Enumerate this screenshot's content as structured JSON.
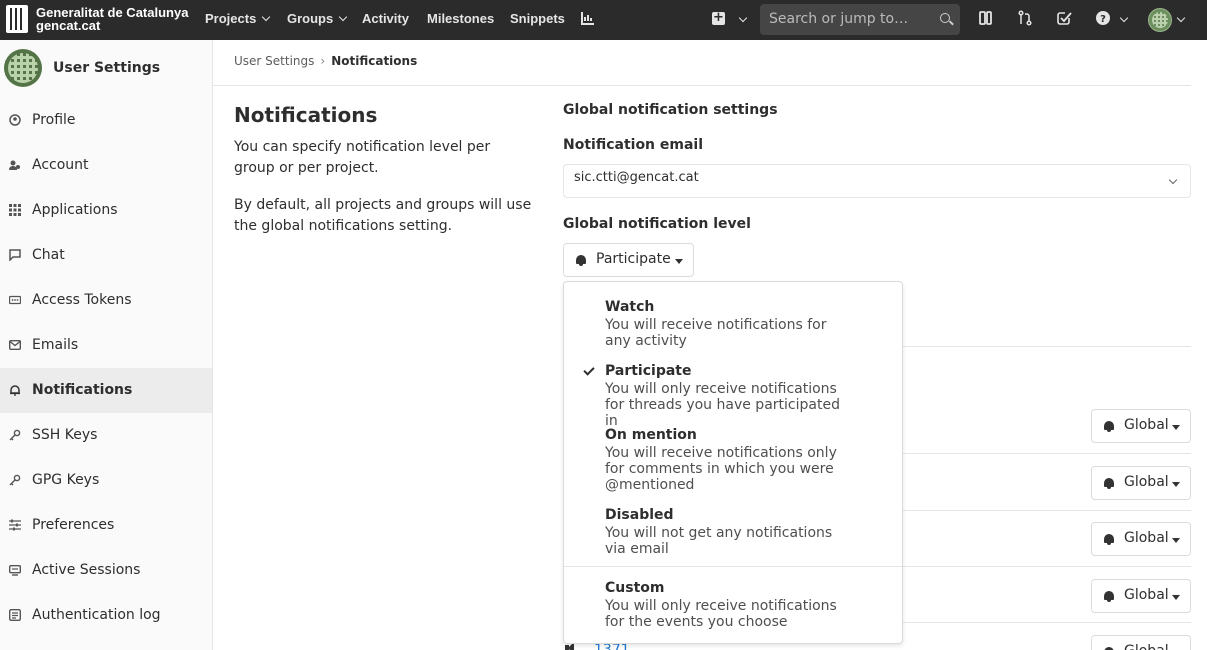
{
  "navbar": {
    "brand_line1": "Generalitat de Catalunya",
    "brand_line2": "gencat.cat",
    "items": [
      {
        "label": "Projects",
        "has_caret": true
      },
      {
        "label": "Groups",
        "has_caret": true
      },
      {
        "label": "Activity",
        "has_caret": false
      },
      {
        "label": "Milestones",
        "has_caret": false
      },
      {
        "label": "Snippets",
        "has_caret": false
      }
    ],
    "search_placeholder": "Search or jump to…",
    "bg_color": "#2b2b2b",
    "icons": [
      "chart-icon",
      "plus-icon",
      "sidebar-panel-icon",
      "merge-request-icon",
      "todo-check-icon",
      "help-icon",
      "user-avatar"
    ]
  },
  "sidebar": {
    "title": "User Settings",
    "items": [
      {
        "label": "Profile",
        "icon": "profile-icon",
        "active": false
      },
      {
        "label": "Account",
        "icon": "account-icon",
        "active": false
      },
      {
        "label": "Applications",
        "icon": "applications-icon",
        "active": false
      },
      {
        "label": "Chat",
        "icon": "chat-icon",
        "active": false
      },
      {
        "label": "Access Tokens",
        "icon": "token-icon",
        "active": false
      },
      {
        "label": "Emails",
        "icon": "mail-icon",
        "active": false
      },
      {
        "label": "Notifications",
        "icon": "bell-icon",
        "active": true
      },
      {
        "label": "SSH Keys",
        "icon": "key-icon",
        "active": false
      },
      {
        "label": "GPG Keys",
        "icon": "key-icon",
        "active": false
      },
      {
        "label": "Preferences",
        "icon": "preferences-icon",
        "active": false
      },
      {
        "label": "Active Sessions",
        "icon": "sessions-icon",
        "active": false
      },
      {
        "label": "Authentication log",
        "icon": "log-icon",
        "active": false
      }
    ]
  },
  "breadcrumb": {
    "parent": "User Settings",
    "separator": "›",
    "current": "Notifications"
  },
  "main": {
    "title": "Notifications",
    "description_1": "You can specify notification level per group or per project.",
    "description_2": "By default, all projects and groups will use the global notifications setting.",
    "global_settings_label": "Global notification settings",
    "email_label": "Notification email",
    "email_value": "sic.ctti@gencat.cat",
    "level_label": "Global notification level",
    "level_value": "Participate",
    "row_button_label": "Global",
    "project_link": "1371"
  },
  "dropdown": {
    "selected": "Participate",
    "options": [
      {
        "title": "Watch",
        "description": "You will receive notifications for any activity"
      },
      {
        "title": "Participate",
        "description": "You will only receive notifications for threads you have participated in"
      },
      {
        "title": "On mention",
        "description": "You will receive notifications only for comments in which you were @mentioned"
      },
      {
        "title": "Disabled",
        "description": "You will not get any notifications via email"
      },
      {
        "title": "Custom",
        "description": "You will only receive notifications for the events you choose"
      }
    ]
  }
}
